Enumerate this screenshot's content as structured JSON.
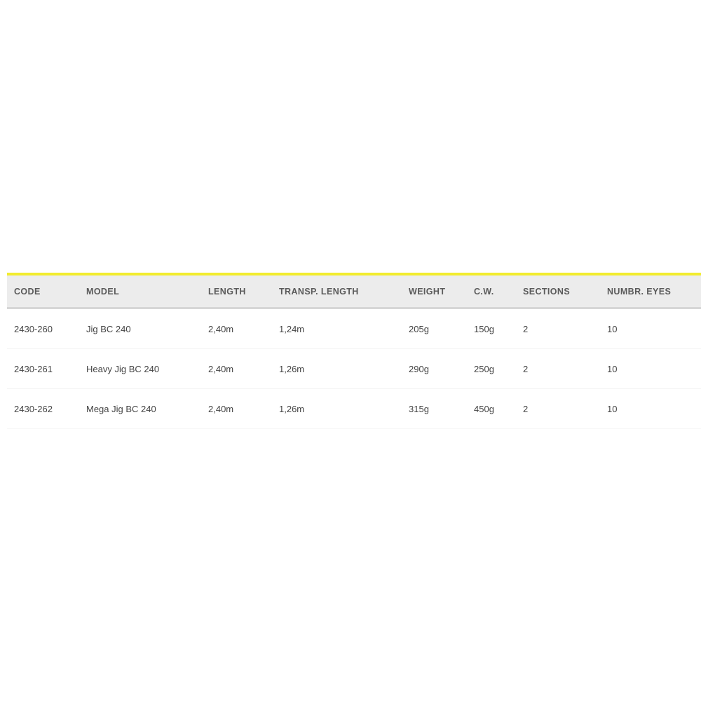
{
  "theme": {
    "accent_color": "#f2ec2e",
    "header_background": "#ececec",
    "header_text_color": "#5a5a5a",
    "body_text_color": "#434343",
    "page_background": "#ffffff"
  },
  "table": {
    "columns": [
      {
        "key": "code",
        "label": "CODE"
      },
      {
        "key": "model",
        "label": "MODEL"
      },
      {
        "key": "length",
        "label": "LENGTH"
      },
      {
        "key": "transp",
        "label": "TRANSP. LENGTH"
      },
      {
        "key": "weight",
        "label": "WEIGHT"
      },
      {
        "key": "cw",
        "label": "C.W."
      },
      {
        "key": "sections",
        "label": "SECTIONS"
      },
      {
        "key": "eyes",
        "label": "NUMBR. EYES"
      }
    ],
    "rows": [
      {
        "code": "2430-260",
        "model": "Jig BC 240",
        "length": "2,40m",
        "transp": "1,24m",
        "weight": "205g",
        "cw": "150g",
        "sections": "2",
        "eyes": "10"
      },
      {
        "code": "2430-261",
        "model": "Heavy Jig BC 240",
        "length": "2,40m",
        "transp": "1,26m",
        "weight": "290g",
        "cw": "250g",
        "sections": "2",
        "eyes": "10"
      },
      {
        "code": "2430-262",
        "model": "Mega Jig BC 240",
        "length": "2,40m",
        "transp": "1,26m",
        "weight": "315g",
        "cw": "450g",
        "sections": "2",
        "eyes": "10"
      }
    ]
  }
}
